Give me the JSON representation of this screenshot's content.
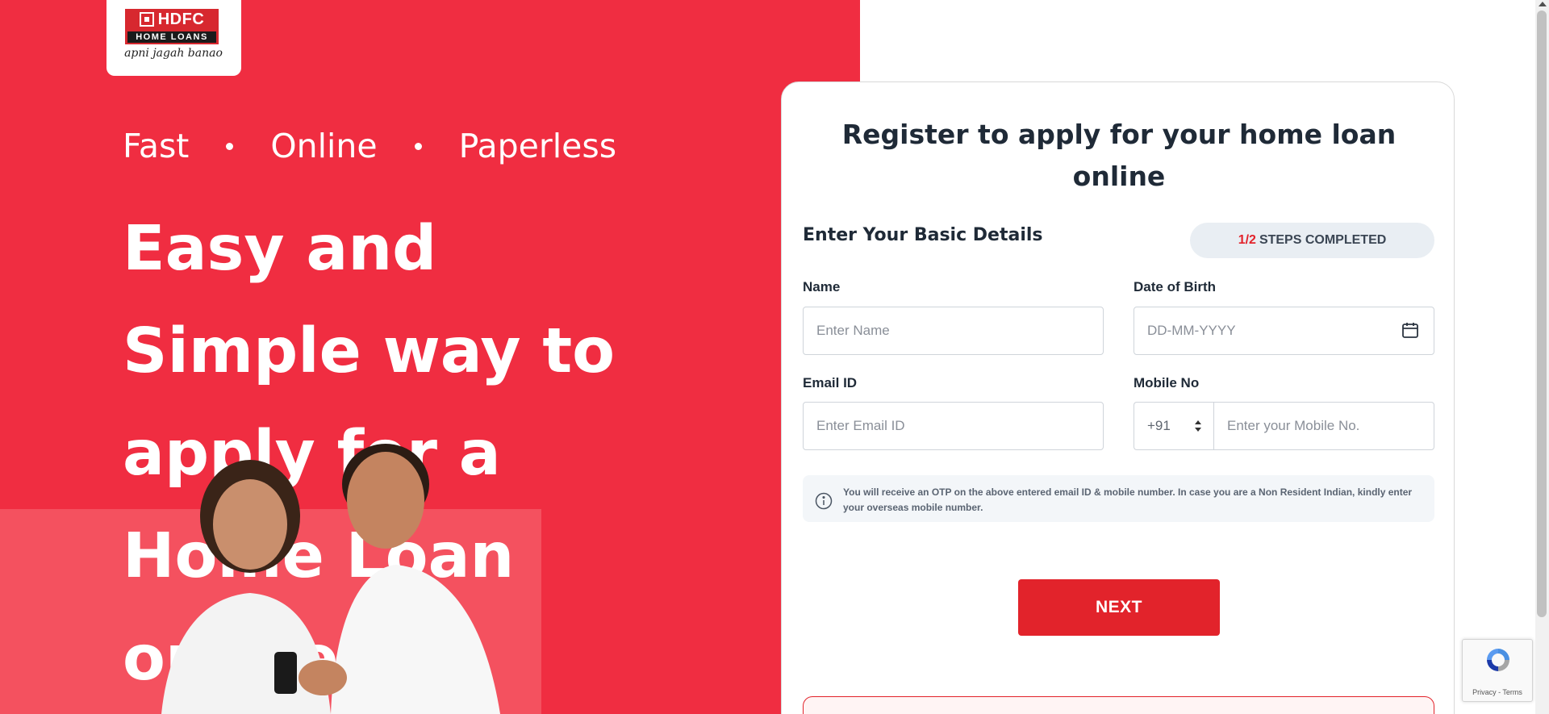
{
  "brand": {
    "name": "HDFC",
    "subtitle": "HOME LOANS",
    "tagline": "apni jagah banao",
    "primary_color": "#f02d41",
    "accent_color": "#e2232b"
  },
  "hero": {
    "tagline_parts": [
      "Fast",
      "Online",
      "Paperless"
    ],
    "headline": "Easy and Simple way to apply for a Home Loan online"
  },
  "form": {
    "title": "Register to apply for your home loan online",
    "section_title": "Enter Your Basic Details",
    "steps": {
      "done": "1/2",
      "label": "STEPS COMPLETED"
    },
    "fields": {
      "name": {
        "label": "Name",
        "placeholder": "Enter Name",
        "value": ""
      },
      "dob": {
        "label": "Date of Birth",
        "placeholder": "DD-MM-YYYY",
        "value": ""
      },
      "email": {
        "label": "Email ID",
        "placeholder": "Enter Email ID",
        "value": ""
      },
      "mobile": {
        "label": "Mobile No",
        "country_code": "+91",
        "placeholder": "Enter your Mobile No.",
        "value": ""
      }
    },
    "info_text": "You will receive an OTP on the above entered email ID & mobile number. In case you are a Non Resident Indian, kindly enter your overseas mobile number.",
    "next_label": "NEXT"
  },
  "recaptcha": {
    "links": "Privacy - Terms"
  },
  "icons": {
    "calendar": "calendar-icon",
    "info": "info-icon",
    "select_caret": "chevron-up-down-icon",
    "recaptcha": "recaptcha-icon"
  }
}
